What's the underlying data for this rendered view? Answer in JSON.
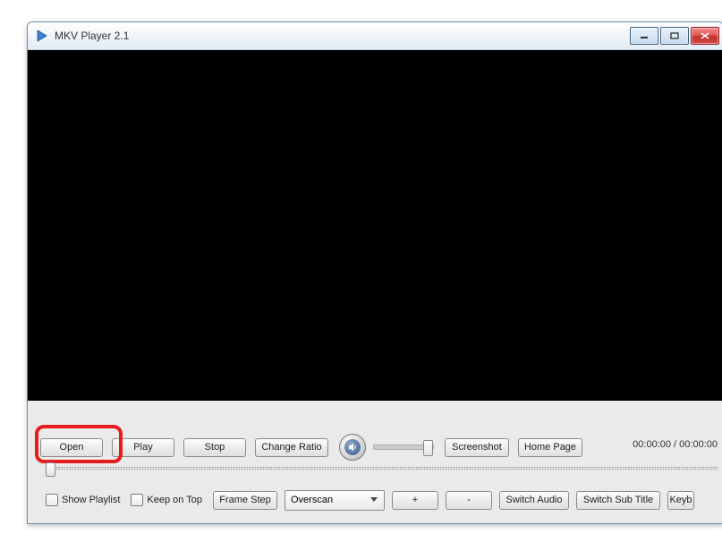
{
  "title": "MKV Player 2.1",
  "toolbar": {
    "open": "Open",
    "play": "Play",
    "stop": "Stop",
    "change_ratio": "Change Ratio",
    "screenshot": "Screenshot",
    "home_page": "Home Page"
  },
  "time": {
    "elapsed": "00:00:00",
    "total": "00:00:00",
    "separator": " / "
  },
  "options": {
    "show_playlist": "Show Playlist",
    "keep_on_top": "Keep on Top",
    "frame_step": "Frame Step",
    "overscan": "Overscan",
    "plus": "+",
    "minus": "-",
    "switch_audio": "Switch Audio",
    "switch_sub_title": "Switch Sub Title",
    "keyb": "Keyb"
  }
}
